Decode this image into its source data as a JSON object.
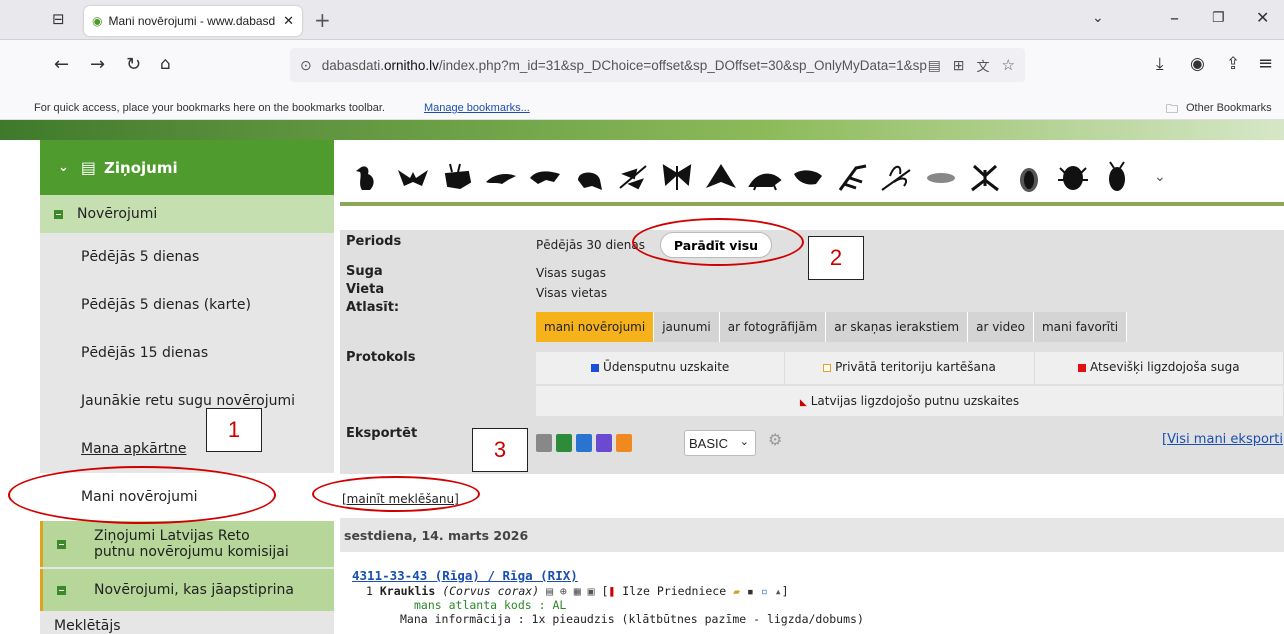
{
  "browser": {
    "tab_title": "Mani novērojumi - www.dabasd",
    "url_prefix": "dabasdati.",
    "url_domain": "ornitho.lv",
    "url_rest": "/index.php?m_id=31&sp_DChoice=offset&sp_DOffset=30&sp_OnlyMyData=1&sp",
    "bookmarks_hint": "For quick access, place your bookmarks here on the bookmarks toolbar.",
    "manage_bookmarks": "Manage bookmarks...",
    "other_bookmarks": "Other Bookmarks"
  },
  "sidebar": {
    "header": "Ziņojumi",
    "sub": "Novērojumi",
    "items": [
      "Pēdējās 5 dienas",
      "Pēdējās 5 dienas (karte)",
      "Pēdējās 15 dienas",
      "Jaunākie retu sugu novērojumi",
      "Mana apkārtne",
      "Mani novērojumi"
    ],
    "green_items": [
      "Ziņojumi Latvijas Reto putnu novērojumu komisijai",
      "Novērojumi, kas jāapstiprina"
    ],
    "last": "Meklētājs"
  },
  "filter": {
    "periods_label": "Periods",
    "periods_value": "Pēdējās 30 dienas",
    "show_all": "Parādīt visu",
    "suga_label": "Suga",
    "suga_value": "Visas sugas",
    "vieta_label": "Vieta",
    "vieta_value": "Visas vietas",
    "atlasit_label": "Atlasīt:",
    "tabs": [
      "mani novērojumi",
      "jaunumi",
      "ar fotogrāfijām",
      "ar skaņas ierakstiem",
      "ar video",
      "mani favorīti"
    ],
    "protokols_label": "Protokols",
    "protocols": [
      "Ūdensputnu uzskaite",
      "Privātā teritoriju kartēšana",
      "Atsevišķi ligzdojoša suga"
    ],
    "protocol_colors": [
      "#1a4fd8",
      "#f0a020",
      "#e01010"
    ],
    "protocol2": "Latvijas ligzdojošo putnu uzskaites",
    "eksportet_label": "Eksportēt",
    "export_format": "BASIC",
    "visi_eksporti": "[Visi mani eksporti"
  },
  "results": {
    "change_search": "[mainīt meklēšanu]",
    "date": "sestdiena, 14. marts 2026",
    "location": "4311-33-43 (Rīga) / Rīga (RIX)",
    "count": "1",
    "species": "Krauklis",
    "latin": "(Corvus corax)",
    "observer": "Ilze Priedniece",
    "atlas": "mans atlanta kods : AL",
    "info": "Mana informācija : 1x pieaudzis (klātbūtnes pazīme - ligzda/dobums)"
  },
  "annotations": [
    "1",
    "2",
    "3"
  ]
}
